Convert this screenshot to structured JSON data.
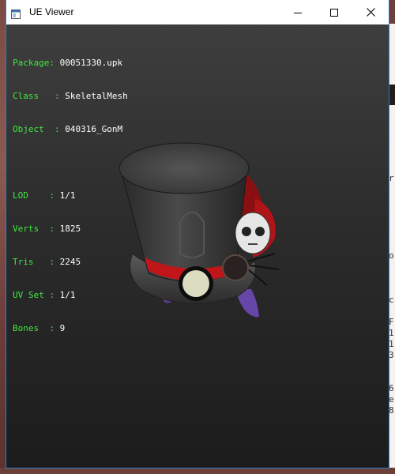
{
  "window": {
    "title": "UE Viewer",
    "controls": {
      "minimize_icon": "minimize-icon",
      "maximize_icon": "maximize-icon",
      "close_icon": "close-icon"
    }
  },
  "info": {
    "package_label": "Package",
    "package_value": "00051330.upk",
    "class_label": "Class",
    "class_value": "SkeletalMesh",
    "object_label": "Object",
    "object_value": "040316_GonM",
    "lod_label": "LOD",
    "lod_value": "1/1",
    "verts_label": "Verts",
    "verts_value": "1825",
    "tris_label": "Tris",
    "tris_value": "2245",
    "uvset_label": "UV Set",
    "uvset_value": "1/1",
    "bones_label": "Bones",
    "bones_value": "9"
  },
  "background_text": {
    "r": "r",
    "o": "o",
    "c": "c",
    "f": "F",
    "n1": "1",
    "n2": "1",
    "n3": "3",
    "n6": "6",
    "e": "e",
    "n8": "8"
  },
  "colors": {
    "label": "#3ee83e",
    "value": "#ffffff",
    "viewport_top": "#3e3e3e",
    "viewport_bottom": "#1c1c1c"
  }
}
